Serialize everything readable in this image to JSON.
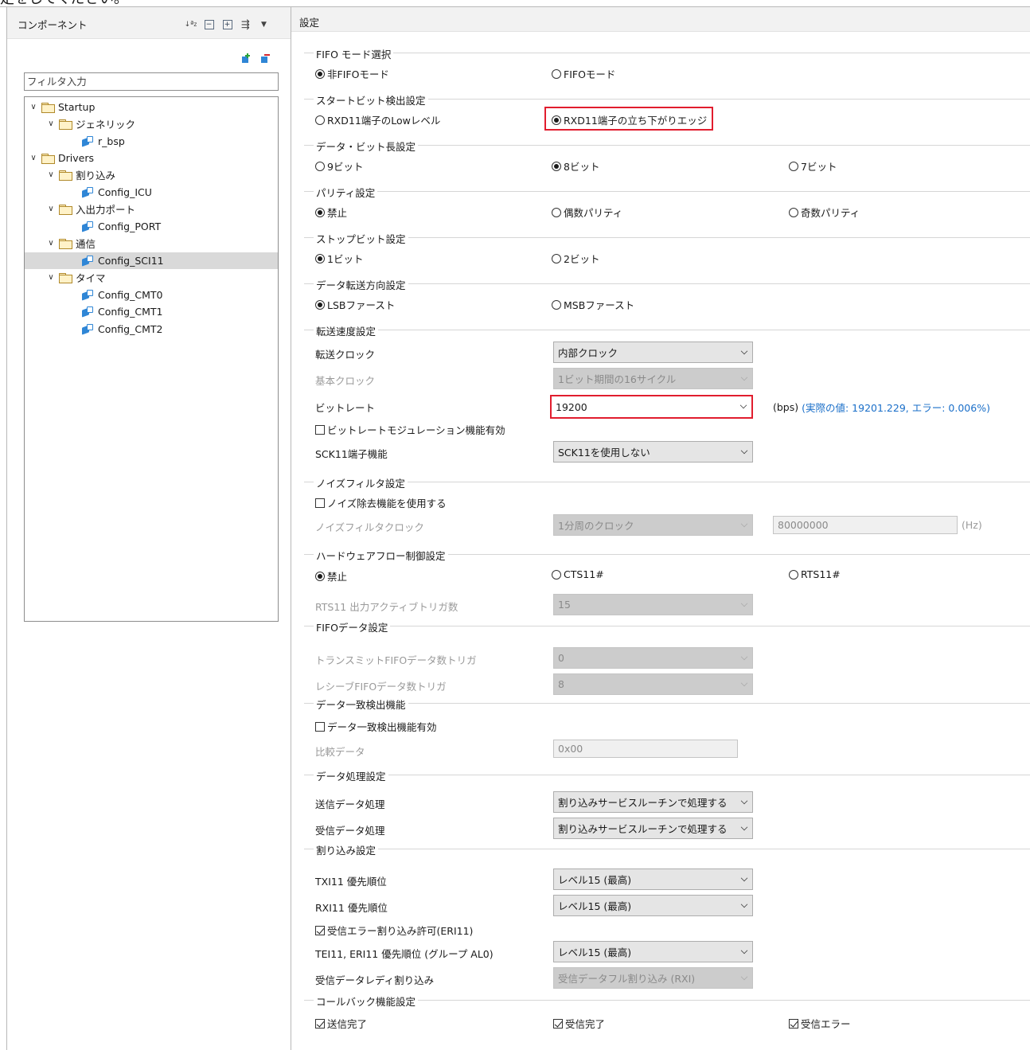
{
  "top_text": "定をしてください。",
  "left_panel": {
    "title": "コンポーネント",
    "filter_placeholder": "フィルタ入力",
    "tree": [
      {
        "label": "Startup",
        "type": "folder"
      },
      {
        "label": "ジェネリック",
        "type": "folder"
      },
      {
        "label": "r_bsp",
        "type": "component"
      },
      {
        "label": "Drivers",
        "type": "folder"
      },
      {
        "label": "割り込み",
        "type": "folder"
      },
      {
        "label": "Config_ICU",
        "type": "component"
      },
      {
        "label": "入出力ポート",
        "type": "folder"
      },
      {
        "label": "Config_PORT",
        "type": "component"
      },
      {
        "label": "通信",
        "type": "folder"
      },
      {
        "label": "Config_SCI11",
        "type": "component",
        "selected": true
      },
      {
        "label": "タイマ",
        "type": "folder"
      },
      {
        "label": "Config_CMT0",
        "type": "component"
      },
      {
        "label": "Config_CMT1",
        "type": "component"
      },
      {
        "label": "Config_CMT2",
        "type": "component"
      }
    ]
  },
  "right_panel": {
    "title": "設定",
    "fifo": {
      "title": "FIFO モード選択",
      "opt1": "非FIFOモード",
      "opt2": "FIFOモード"
    },
    "start_bit": {
      "title": "スタートビット検出設定",
      "opt1": "RXD11端子のLowレベル",
      "opt2": "RXD11端子の立ち下がりエッジ"
    },
    "data_bit": {
      "title": "データ・ビット長設定",
      "opt1": "9ビット",
      "opt2": "8ビット",
      "opt3": "7ビット"
    },
    "parity": {
      "title": "パリティ設定",
      "opt1": "禁止",
      "opt2": "偶数パリティ",
      "opt3": "奇数パリティ"
    },
    "stop_bit": {
      "title": "ストップビット設定",
      "opt1": "1ビット",
      "opt2": "2ビット"
    },
    "direction": {
      "title": "データ転送方向設定",
      "opt1": "LSBファースト",
      "opt2": "MSBファースト"
    },
    "speed": {
      "title": "転送速度設定",
      "clock_label": "転送クロック",
      "clock_value": "内部クロック",
      "base_label": "基本クロック",
      "base_value": "1ビット期間の16サイクル",
      "bitrate_label": "ビットレート",
      "bitrate_value": "19200",
      "bitrate_unit": "(bps)",
      "bitrate_actual": "(実際の値: 19201.229, エラー: 0.006%)",
      "modulation_label": "ビットレートモジュレーション機能有効",
      "sck_label": "SCK11端子機能",
      "sck_value": "SCK11を使用しない"
    },
    "noise": {
      "title": "ノイズフィルタ設定",
      "enable_label": "ノイズ除去機能を使用する",
      "clock_label": "ノイズフィルタクロック",
      "clock_value": "1分周のクロック",
      "freq_value": "80000000",
      "freq_unit": "(Hz)"
    },
    "flow": {
      "title": "ハードウェアフロー制御設定",
      "opt1": "禁止",
      "opt2": "CTS11#",
      "opt3": "RTS11#",
      "rts_label": "RTS11 出力アクティブトリガ数",
      "rts_value": "15"
    },
    "fifo_data": {
      "title": "FIFOデータ設定",
      "tx_label": "トランスミットFIFOデータ数トリガ",
      "tx_value": "0",
      "rx_label": "レシーブFIFOデータ数トリガ",
      "rx_value": "8"
    },
    "match": {
      "title": "データ一致検出機能",
      "enable_label": "データ一致検出機能有効",
      "compare_label": "比較データ",
      "compare_value": "0x00"
    },
    "processing": {
      "title": "データ処理設定",
      "tx_label": "送信データ処理",
      "tx_value": "割り込みサービスルーチンで処理する",
      "rx_label": "受信データ処理",
      "rx_value": "割り込みサービスルーチンで処理する"
    },
    "interrupt": {
      "title": "割り込み設定",
      "txi_label": "TXI11 優先順位",
      "txi_value": "レベル15 (最高)",
      "rxi_label": "RXI11 優先順位",
      "rxi_value": "レベル15 (最高)",
      "eri_label": "受信エラー割り込み許可(ERI11)",
      "tei_label": "TEI11, ERI11 優先順位 (グループ AL0)",
      "tei_value": "レベル15 (最高)",
      "ready_label": "受信データレディ割り込み",
      "ready_value": "受信データフル割り込み (RXI)"
    },
    "callback": {
      "title": "コールバック機能設定",
      "opt1": "送信完了",
      "opt2": "受信完了",
      "opt3": "受信エラー"
    }
  }
}
